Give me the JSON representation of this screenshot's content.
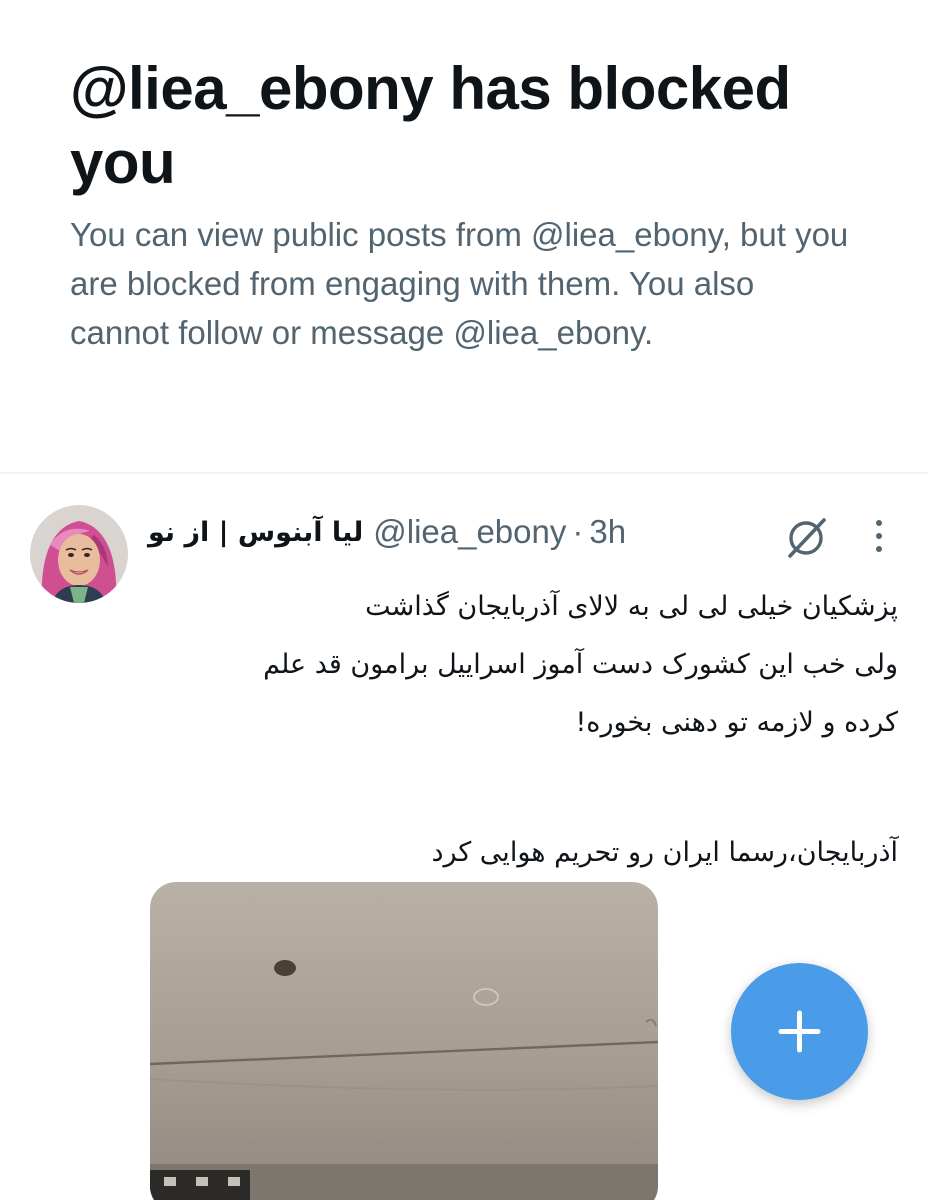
{
  "block_notice": {
    "title": "@liea_ebony has blocked you",
    "description": "You can view public posts from @liea_ebony, but you are blocked from engaging with them. You also cannot follow or message @liea_ebony."
  },
  "post": {
    "display_name": "لیا آبنوس | از نو",
    "handle": "@liea_ebony",
    "separator": "·",
    "time": "3h",
    "lines": [
      "پزشکیان خیلی لی لی به لالای آذربایجان گذاشت",
      "ولی خب این کشورک دست آموز اسراییل برامون قد علم",
      "کرده و لازمه تو دهنی بخوره!"
    ],
    "lines_after_gap": [
      "آذربایجان،رسما ایران رو تحریم هوایی کرد"
    ],
    "avatar_icon": "avatar-photo",
    "media_icon": "airplane-cabin-photo",
    "grok_icon": "grok-icon",
    "more_icon": "more-vertical-icon"
  },
  "compose_button": {
    "icon": "plus-icon",
    "color": "#4a9be8"
  },
  "colors": {
    "primary_text": "#0f1419",
    "secondary_text": "#536471",
    "divider": "#eff3f4"
  }
}
